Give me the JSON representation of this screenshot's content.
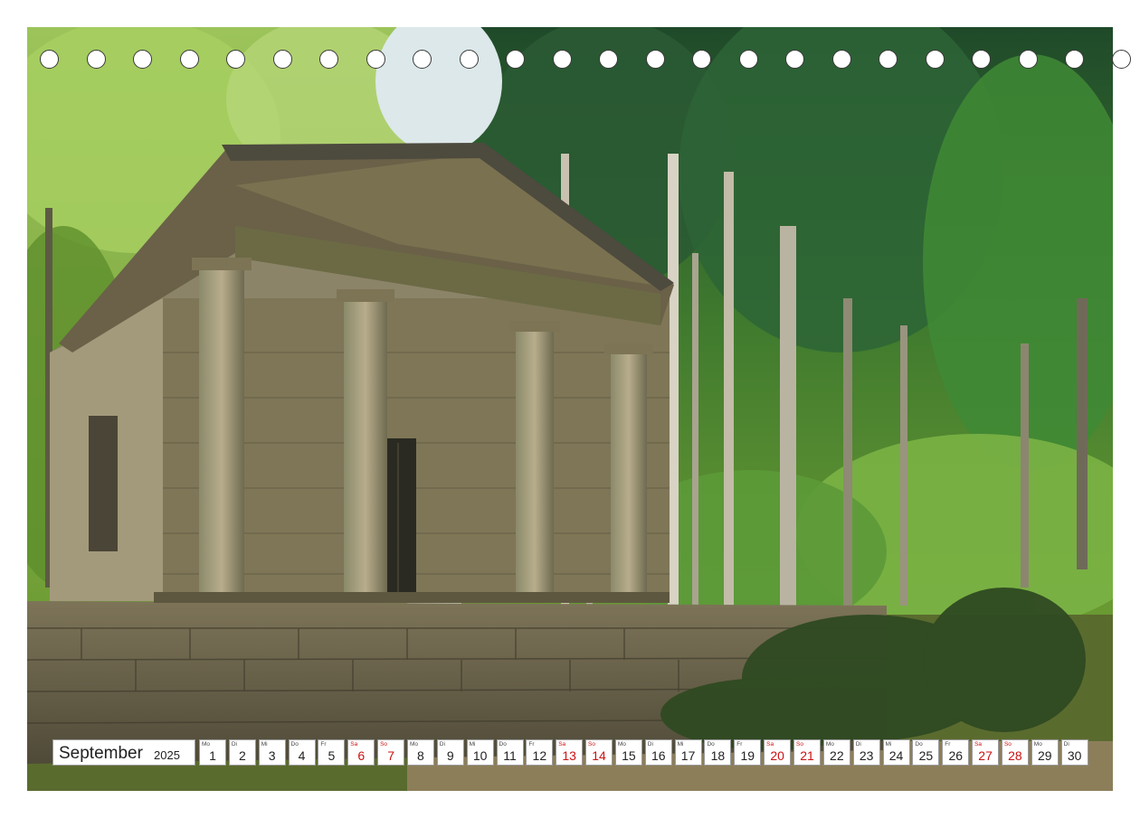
{
  "calendar": {
    "month": "September",
    "year": "2025",
    "days": [
      {
        "dow": "Mo",
        "num": "1",
        "weekend": false
      },
      {
        "dow": "Di",
        "num": "2",
        "weekend": false
      },
      {
        "dow": "Mi",
        "num": "3",
        "weekend": false
      },
      {
        "dow": "Do",
        "num": "4",
        "weekend": false
      },
      {
        "dow": "Fr",
        "num": "5",
        "weekend": false
      },
      {
        "dow": "Sa",
        "num": "6",
        "weekend": true
      },
      {
        "dow": "So",
        "num": "7",
        "weekend": true
      },
      {
        "dow": "Mo",
        "num": "8",
        "weekend": false
      },
      {
        "dow": "Di",
        "num": "9",
        "weekend": false
      },
      {
        "dow": "Mi",
        "num": "10",
        "weekend": false
      },
      {
        "dow": "Do",
        "num": "11",
        "weekend": false
      },
      {
        "dow": "Fr",
        "num": "12",
        "weekend": false
      },
      {
        "dow": "Sa",
        "num": "13",
        "weekend": true
      },
      {
        "dow": "So",
        "num": "14",
        "weekend": true
      },
      {
        "dow": "Mo",
        "num": "15",
        "weekend": false
      },
      {
        "dow": "Di",
        "num": "16",
        "weekend": false
      },
      {
        "dow": "Mi",
        "num": "17",
        "weekend": false
      },
      {
        "dow": "Do",
        "num": "18",
        "weekend": false
      },
      {
        "dow": "Fr",
        "num": "19",
        "weekend": false
      },
      {
        "dow": "Sa",
        "num": "20",
        "weekend": true
      },
      {
        "dow": "So",
        "num": "21",
        "weekend": true
      },
      {
        "dow": "Mo",
        "num": "22",
        "weekend": false
      },
      {
        "dow": "Di",
        "num": "23",
        "weekend": false
      },
      {
        "dow": "Mi",
        "num": "24",
        "weekend": false
      },
      {
        "dow": "Do",
        "num": "25",
        "weekend": false
      },
      {
        "dow": "Fr",
        "num": "26",
        "weekend": false
      },
      {
        "dow": "Sa",
        "num": "27",
        "weekend": true
      },
      {
        "dow": "So",
        "num": "28",
        "weekend": true
      },
      {
        "dow": "Mo",
        "num": "29",
        "weekend": false
      },
      {
        "dow": "Di",
        "num": "30",
        "weekend": false
      }
    ]
  },
  "binding": {
    "hole_count": 24
  },
  "colors": {
    "weekend": "#cc1111",
    "text": "#222222",
    "frame": "#9a9a9a"
  }
}
